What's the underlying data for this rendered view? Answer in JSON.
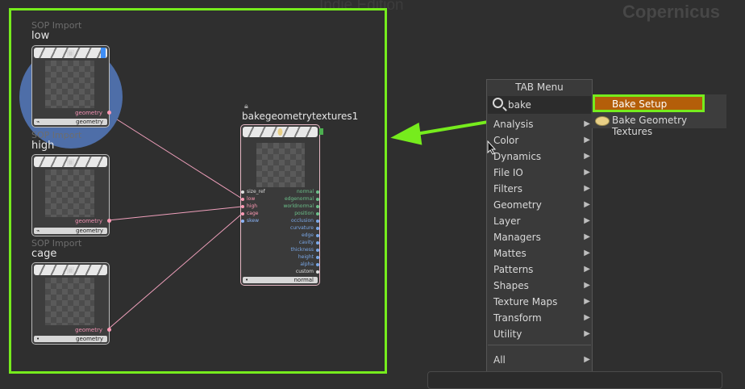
{
  "watermark": {
    "left": "Indie Edition",
    "right": "Copernicus"
  },
  "nodes": {
    "low": {
      "type": "SOP Import",
      "name": "low",
      "output_label": "geometry",
      "footer": "geometry"
    },
    "high": {
      "type": "SOP Import",
      "name": "high",
      "output_label": "geometry",
      "footer": "geometry"
    },
    "cage": {
      "type": "SOP Import",
      "name": "cage",
      "output_label": "geometry",
      "footer": "geometry"
    }
  },
  "bake_node": {
    "name": "bakegeometrytextures1",
    "inputs": [
      "size_ref",
      "low",
      "high",
      "cage",
      "skew"
    ],
    "outputs": [
      "normal",
      "edgenormal",
      "worldnormal",
      "position",
      "occlusion",
      "curvature",
      "edge",
      "cavity",
      "thickness",
      "height",
      "alpha",
      "custom"
    ],
    "footer": "normal"
  },
  "tab_menu": {
    "title": "TAB Menu",
    "search_value": "bake",
    "items": [
      "Analysis",
      "Color",
      "Dynamics",
      "File IO",
      "Filters",
      "Geometry",
      "Layer",
      "Managers",
      "Mattes",
      "Patterns",
      "Shapes",
      "Texture Maps",
      "Transform",
      "Utility"
    ],
    "all_label": "All",
    "arrow": "▶"
  },
  "submenu": {
    "bake_setup": "Bake Setup",
    "bake_geometry_textures": "Bake Geometry Textures"
  },
  "colors": {
    "highlight": "#76ec1d",
    "selected_item": "#b45e09",
    "wire": "#f0a0bc"
  }
}
